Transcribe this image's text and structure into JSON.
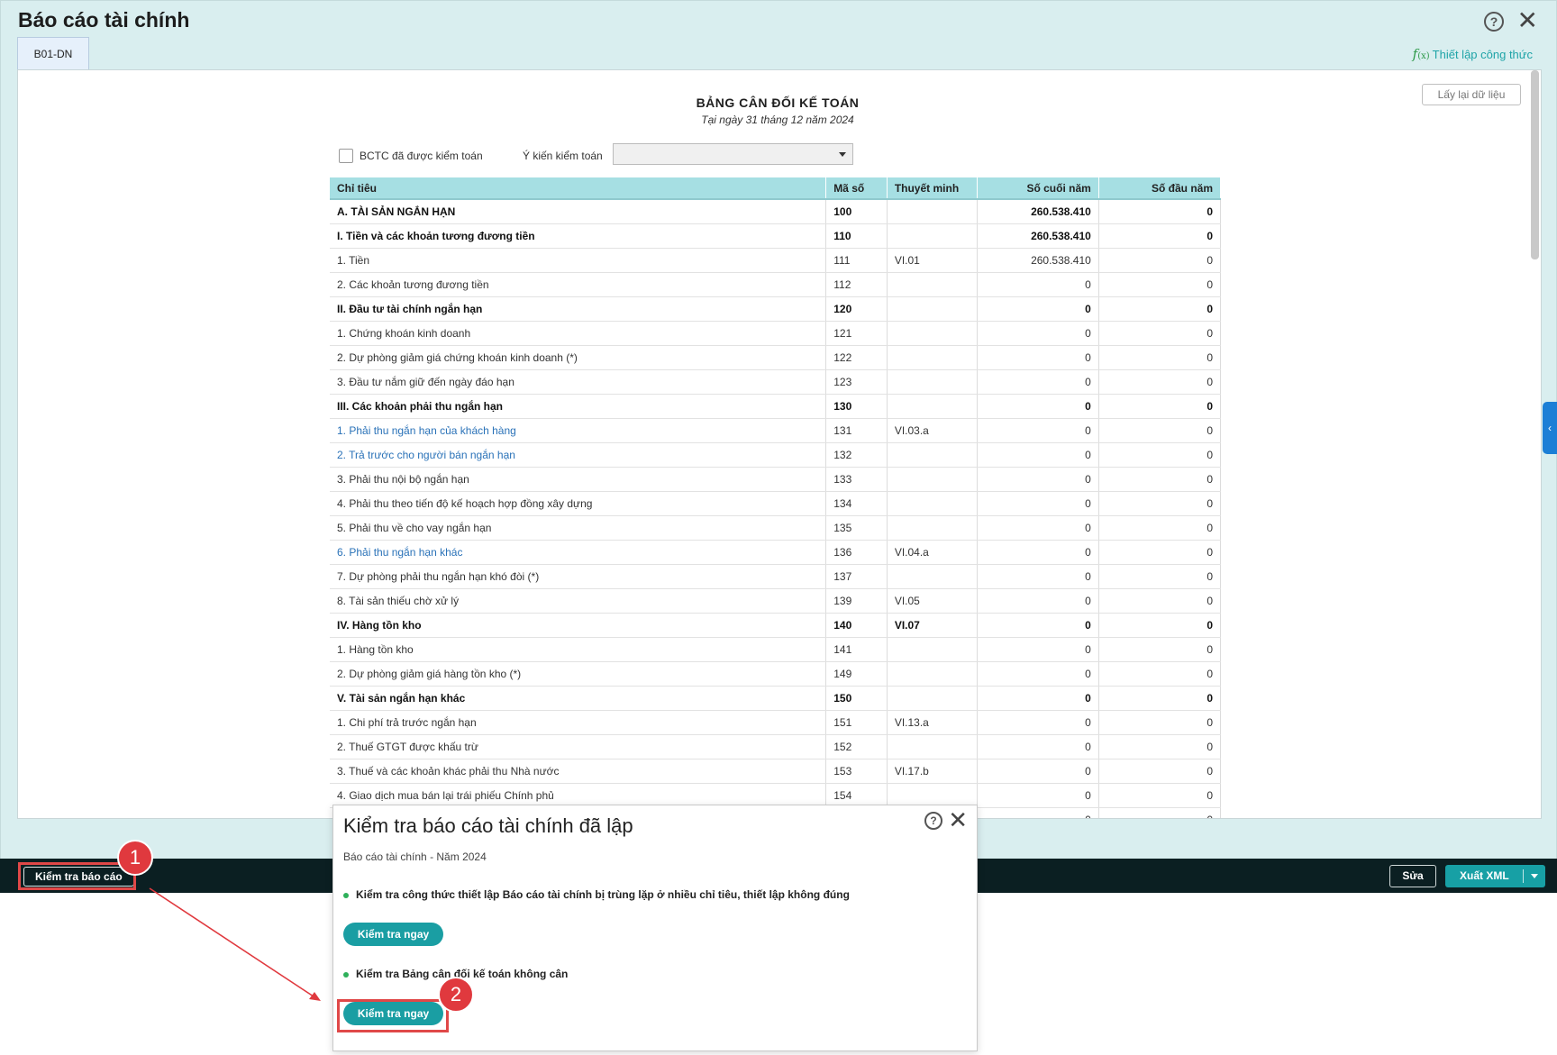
{
  "window": {
    "title": "Báo cáo tài chính",
    "tab_label": "B01-DN",
    "formula_link": "Thiết lập công thức",
    "formula_icon_text": "f",
    "formula_icon_sub": "(x)",
    "help_icon": "?",
    "close_icon": "✕"
  },
  "report": {
    "title": "BẢNG CÂN ĐỐI KẾ TOÁN",
    "subtitle": "Tại ngày 31 tháng 12 năm 2024",
    "reload_label": "Lấy lại dữ liệu",
    "audited_label": "BCTC đã được kiểm toán",
    "opinion_label": "Ý kiến kiểm toán",
    "opinion_value": ""
  },
  "table": {
    "headers": [
      "Chỉ tiêu",
      "Mã số",
      "Thuyết minh",
      "Số cuối năm",
      "Số đầu năm"
    ],
    "rows": [
      {
        "name": "A. TÀI SẢN NGẮN HẠN",
        "code": "100",
        "note": "",
        "end": "260.538.410",
        "start": "0",
        "style": "bold"
      },
      {
        "name": "I. Tiền và các khoản tương đương tiền",
        "code": "110",
        "note": "",
        "end": "260.538.410",
        "start": "0",
        "style": "bold"
      },
      {
        "name": "1. Tiền",
        "code": "111",
        "note": "VI.01",
        "end": "260.538.410",
        "start": "0",
        "style": ""
      },
      {
        "name": "2. Các khoản tương đương tiền",
        "code": "112",
        "note": "",
        "end": "0",
        "start": "0",
        "style": ""
      },
      {
        "name": "II. Đầu tư tài chính ngắn hạn",
        "code": "120",
        "note": "",
        "end": "0",
        "start": "0",
        "style": "bold"
      },
      {
        "name": "1. Chứng khoán kinh doanh",
        "code": "121",
        "note": "",
        "end": "0",
        "start": "0",
        "style": ""
      },
      {
        "name": "2. Dự phòng giảm giá chứng khoán kinh doanh (*)",
        "code": "122",
        "note": "",
        "end": "0",
        "start": "0",
        "style": ""
      },
      {
        "name": "3. Đầu tư nắm giữ đến ngày đáo hạn",
        "code": "123",
        "note": "",
        "end": "0",
        "start": "0",
        "style": ""
      },
      {
        "name": "III. Các khoản phải thu ngắn hạn",
        "code": "130",
        "note": "",
        "end": "0",
        "start": "0",
        "style": "bold"
      },
      {
        "name": "1. Phải thu ngắn hạn của khách hàng",
        "code": "131",
        "note": "VI.03.a",
        "end": "0",
        "start": "0",
        "style": "link"
      },
      {
        "name": "2. Trả trước cho người bán ngắn hạn",
        "code": "132",
        "note": "",
        "end": "0",
        "start": "0",
        "style": "link"
      },
      {
        "name": "3. Phải thu nội bộ ngắn hạn",
        "code": "133",
        "note": "",
        "end": "0",
        "start": "0",
        "style": ""
      },
      {
        "name": "4. Phải thu theo tiến độ kế hoạch hợp đồng xây dựng",
        "code": "134",
        "note": "",
        "end": "0",
        "start": "0",
        "style": ""
      },
      {
        "name": "5. Phải thu về cho vay ngắn hạn",
        "code": "135",
        "note": "",
        "end": "0",
        "start": "0",
        "style": ""
      },
      {
        "name": "6. Phải thu ngắn hạn khác",
        "code": "136",
        "note": "VI.04.a",
        "end": "0",
        "start": "0",
        "style": "link"
      },
      {
        "name": "7. Dự phòng phải thu ngắn hạn khó đòi (*)",
        "code": "137",
        "note": "",
        "end": "0",
        "start": "0",
        "style": ""
      },
      {
        "name": "8. Tài sản thiếu chờ xử lý",
        "code": "139",
        "note": "VI.05",
        "end": "0",
        "start": "0",
        "style": ""
      },
      {
        "name": "IV. Hàng tồn kho",
        "code": "140",
        "note": "VI.07",
        "end": "0",
        "start": "0",
        "style": "bold"
      },
      {
        "name": "1. Hàng tồn kho",
        "code": "141",
        "note": "",
        "end": "0",
        "start": "0",
        "style": ""
      },
      {
        "name": "2. Dự phòng giảm giá hàng tồn kho (*)",
        "code": "149",
        "note": "",
        "end": "0",
        "start": "0",
        "style": ""
      },
      {
        "name": "V. Tài sản ngắn hạn khác",
        "code": "150",
        "note": "",
        "end": "0",
        "start": "0",
        "style": "bold"
      },
      {
        "name": "1. Chi phí trả trước ngắn hạn",
        "code": "151",
        "note": "VI.13.a",
        "end": "0",
        "start": "0",
        "style": ""
      },
      {
        "name": "2. Thuế GTGT được khấu trừ",
        "code": "152",
        "note": "",
        "end": "0",
        "start": "0",
        "style": ""
      },
      {
        "name": "3. Thuế và các khoản khác phải thu Nhà nước",
        "code": "153",
        "note": "VI.17.b",
        "end": "0",
        "start": "0",
        "style": ""
      },
      {
        "name": "4. Giao dịch mua bán lại trái phiếu Chính phủ",
        "code": "154",
        "note": "",
        "end": "0",
        "start": "0",
        "style": ""
      },
      {
        "name": "",
        "code": "",
        "note": "",
        "end": "0",
        "start": "0",
        "style": ""
      }
    ]
  },
  "actionbar": {
    "check_report_label": "Kiểm tra báo cáo",
    "edit_label": "Sửa",
    "export_label": "Xuất XML"
  },
  "dialog": {
    "title": "Kiểm tra báo cáo tài chính đã lập",
    "subtitle": "Báo cáo tài chính - Năm 2024",
    "items": [
      {
        "text": "Kiểm tra công thức thiết lập Báo cáo tài chính bị trùng lặp ở nhiều chỉ tiêu, thiết lập không đúng",
        "button": "Kiểm tra ngay"
      },
      {
        "text": "Kiểm tra Bảng cân đối kế toán không cân",
        "button": "Kiểm tra ngay"
      }
    ],
    "help_icon": "?",
    "close_icon": "✕"
  },
  "annotations": {
    "step1": "1",
    "step2": "2",
    "color": "#e0393e"
  },
  "side_tab_icon": "‹"
}
